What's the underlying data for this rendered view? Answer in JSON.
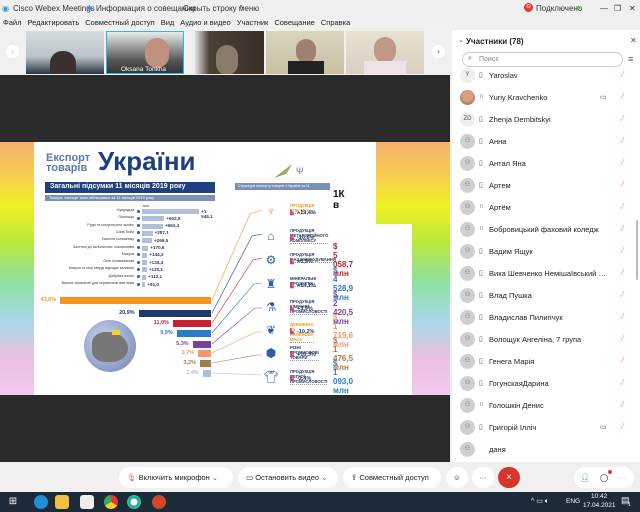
{
  "titlebar": {
    "app": "Cisco Webex Meetings",
    "info": "Информация о совещании",
    "hide_menu": "Скрыть строку меню",
    "status": "Подключено"
  },
  "menu": [
    "Файл",
    "Редактировать",
    "Совместный доступ",
    "Вид",
    "Аудио и видео",
    "Участник",
    "Совещание",
    "Справка"
  ],
  "filmstrip": {
    "active_name": "Oksana Tonkha"
  },
  "slide": {
    "title_small_1": "Експорт",
    "title_small_2": "товарів",
    "title_big": "України",
    "banner": "Загальні підсумки 11 місяців 2019 року",
    "subbanner": "Товари, експорт яких збільшився за 11 місяців 2019 року",
    "unit": "млн дол.",
    "right_banner": "Структура експорту товарів з України за 11",
    "overlay": "1К в",
    "increases": [
      {
        "label": "Кукурудза",
        "value": "+1 545,1",
        "n": 1545.1
      },
      {
        "label": "Пшениця",
        "value": "+602,9",
        "n": 602.9
      },
      {
        "label": "Руди та концентрати залізні",
        "value": "+563,4",
        "n": 563.4
      },
      {
        "label": "Соєві боби",
        "value": "+287,1",
        "n": 287.1
      },
      {
        "label": "Насіння соняшнику",
        "value": "+269,5",
        "n": 269.5
      },
      {
        "label": "Частини до залізничних локомотивів",
        "value": "+170,6",
        "n": 170.6
      },
      {
        "label": "Макуха",
        "value": "+144,2",
        "n": 144.2
      },
      {
        "label": "Олія соняшникова",
        "value": "+134,4",
        "n": 134.4
      },
      {
        "label": "Макуха та інші тверді відходи/ залишки",
        "value": "+130,1",
        "n": 130.1
      },
      {
        "label": "Добрива азотні",
        "value": "+112,1",
        "n": 112.1
      },
      {
        "label": "Вагони залізничні для перевезень вантажів",
        "value": "+91,0",
        "n": 91.0
      }
    ],
    "shares": [
      {
        "label": "43,6%",
        "n": 43.6,
        "color": "#f7941d"
      },
      {
        "label": "20,9%",
        "n": 20.9,
        "color": "#1f3a6e"
      },
      {
        "label": "11,0%",
        "n": 11.0,
        "color": "#c8202f"
      },
      {
        "label": "9,9%",
        "n": 9.9,
        "color": "#2b7cc4"
      },
      {
        "label": "5,3%",
        "n": 5.3,
        "color": "#7b3fa0"
      },
      {
        "label": "3,7%",
        "n": 3.7,
        "color": "#f4956a"
      },
      {
        "label": "3,2%",
        "n": 3.2,
        "color": "#a87a4a"
      },
      {
        "label": "2,4%",
        "n": 2.4,
        "color": "#a9bfdc"
      }
    ],
    "categories": [
      {
        "name": "ПРОДУКЦІЯ АПК ТА Х",
        "delta": "+19,4%",
        "value": "",
        "icon": "wheat-cow",
        "color": "#f7941d"
      },
      {
        "name": "ПРОДУКЦІЯ МЕТАЛУРГІЙНОГО КОМПЛЕКСУ",
        "delta": "-10,6%",
        "value": "$ 5 058,7 млн",
        "icon": "factory",
        "color": "#c8202f"
      },
      {
        "name": "ПРОДУКЦІЯ МАШИНОБУДУВАННЯ",
        "delta": "+0,9%",
        "value": "$ 4 528,9 млн",
        "icon": "gears",
        "color": "#2b7cc4"
      },
      {
        "name": "МІНЕРАЛЬНІ ПРОДУКТИ",
        "delta": "+14,1%",
        "value": "$ 2 420,5 млн",
        "icon": "oil-rig",
        "color": "#7b3fa0"
      },
      {
        "name": "ПРОДУКЦІЯ ХІМІЧНОЇ ПРОМИСЛОВОСТІ",
        "delta": "+3,9%",
        "value": "$ 1 719,6 млн",
        "icon": "flask",
        "color": "#f4956a"
      },
      {
        "name": "ДЕРЕВИНА ТА ПАПЕРОВА МАСА",
        "delta": "-10,2%",
        "value": "$ 1 476,5 млн",
        "icon": "leaf",
        "color": "#a87a4a"
      },
      {
        "name": "РІЗНІ ПРОМИСЛОВІ ТОВАРИ",
        "delta": "+10,3%",
        "value": "$ 1 093,0 млн",
        "icon": "hex-nut",
        "color": "#2b7cc4"
      },
      {
        "name": "ПРОДУКЦІЯ ЛЕГКОЇ ПРОМИСЛОВОСТІ",
        "delta": "-2,4%",
        "value": "",
        "icon": "t-shirt",
        "color": "#2b7cc4"
      }
    ]
  },
  "panel": {
    "title": "Участники (78)",
    "search_placeholder": "Поиск",
    "participants": [
      {
        "initials": "Y",
        "name": "Yaroslav",
        "device": "phone"
      },
      {
        "initials": "",
        "name": "Yuriy Kravchenko",
        "device": "headset",
        "video": true,
        "photo": true
      },
      {
        "initials": "ZD",
        "name": "Zhenja Dembitskyi",
        "device": "phone"
      },
      {
        "name": "Анна",
        "device": "phone"
      },
      {
        "name": "Антал Яна",
        "device": "phone"
      },
      {
        "name": "Артем",
        "device": "phone"
      },
      {
        "name": "Артём",
        "device": "headset"
      },
      {
        "name": "Бобровицький фаховий коледж",
        "device": "headset"
      },
      {
        "name": "Вадим Ящук",
        "device": "phone"
      },
      {
        "name": "Вика Шевченко Немішаївський фа...",
        "device": "phone"
      },
      {
        "name": "Влад Пушка",
        "device": "phone"
      },
      {
        "name": "Владислав Пилипчук",
        "device": "phone"
      },
      {
        "name": "Волощук Ангеліна, 7 група",
        "device": "phone"
      },
      {
        "name": "Генега Марія",
        "device": "phone"
      },
      {
        "name": "ГогунскаяДарина",
        "device": "phone"
      },
      {
        "name": "Голошкін Денис",
        "device": "headset"
      },
      {
        "name": "Григорій Ілліч",
        "device": "phone",
        "video": true
      },
      {
        "name": "даня",
        "device": "none",
        "nomute": true
      }
    ]
  },
  "controls": {
    "mic": "Включить микрофон",
    "video": "Остановить видео",
    "share": "Совместный доступ",
    "more": "···",
    "leave": "×"
  },
  "taskbar": {
    "lang": "ENG",
    "time": "10:42",
    "date": "17.04.2021",
    "notif_count": "1"
  }
}
